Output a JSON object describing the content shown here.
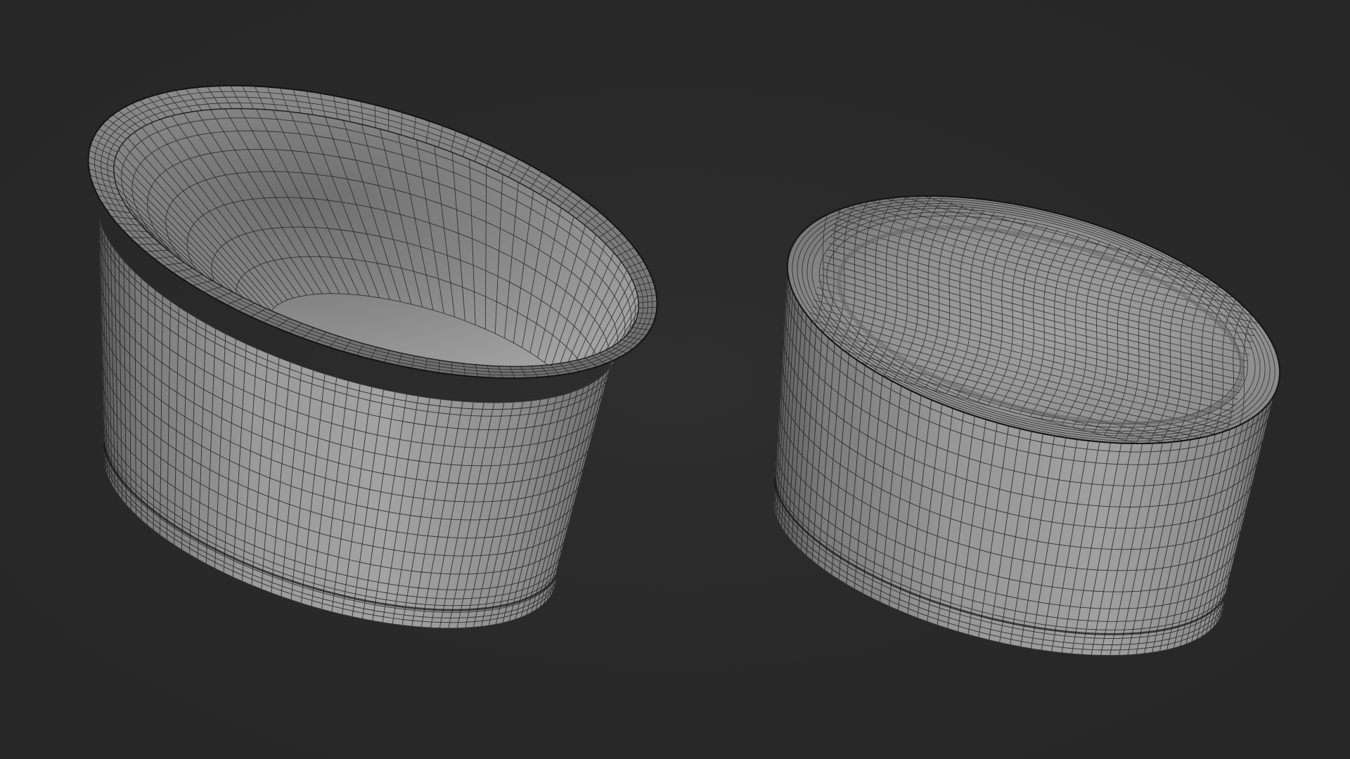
{
  "scene": {
    "background_color": "#2a2a2a",
    "mesh_color": "#8c8c8c",
    "wire_color": "#1e1e1e",
    "objects": [
      {
        "name": "open-cup",
        "view": "top-open"
      },
      {
        "name": "sealed-cup",
        "view": "lidded"
      }
    ]
  }
}
